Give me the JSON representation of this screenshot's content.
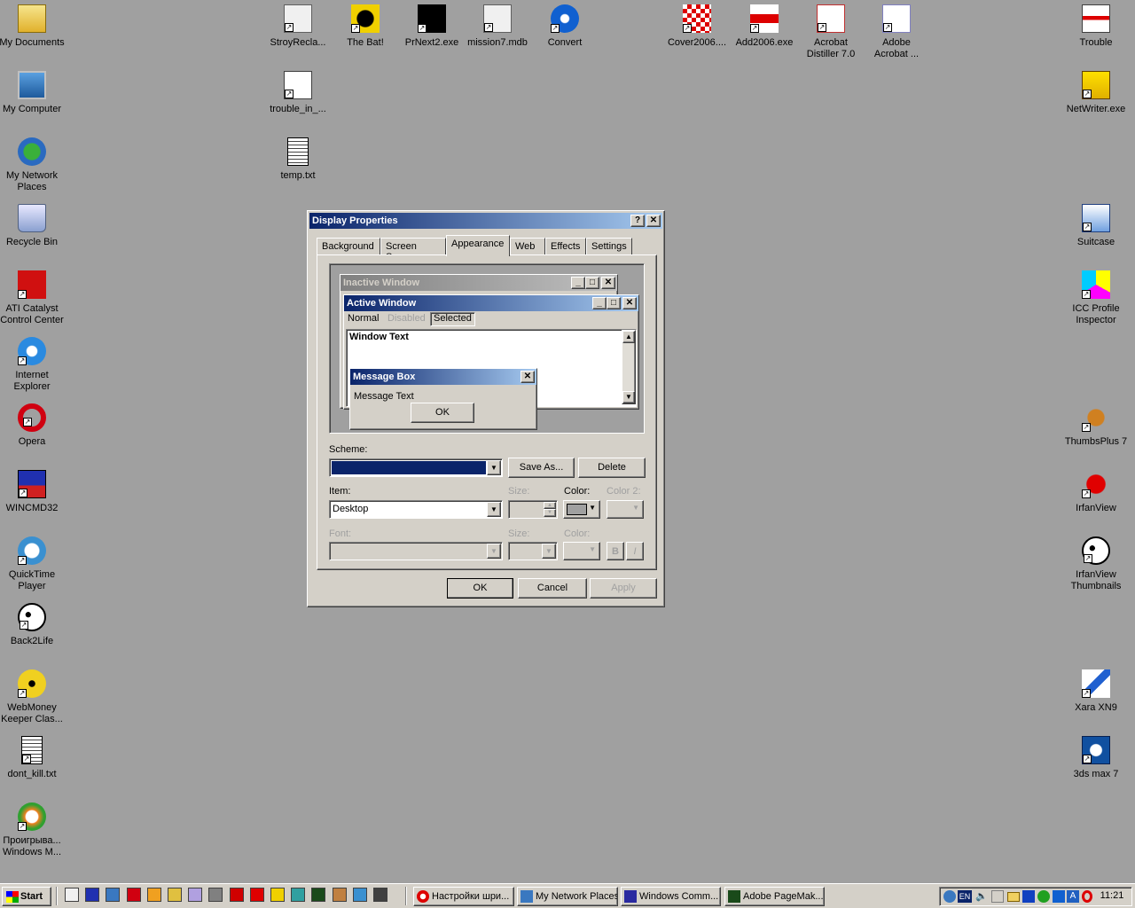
{
  "desktop": {
    "icons": [
      {
        "label": "My Documents",
        "icon": "folder-icon"
      },
      {
        "label": "My Computer",
        "icon": "computer-icon"
      },
      {
        "label": "My Network\nPlaces",
        "icon": "network-icon"
      },
      {
        "label": "Recycle Bin",
        "icon": "recycle-bin-icon"
      },
      {
        "label": "ATI Catalyst\nControl Center",
        "icon": "ati-icon"
      },
      {
        "label": "Internet\nExplorer",
        "icon": "ie-icon"
      },
      {
        "label": "Opera",
        "icon": "opera-icon"
      },
      {
        "label": "WINCMD32",
        "icon": "floppy-icon"
      },
      {
        "label": "QuickTime\nPlayer",
        "icon": "quicktime-icon"
      },
      {
        "label": "Back2Life",
        "icon": "panda-icon"
      },
      {
        "label": "WebMoney\nKeeper Clas...",
        "icon": "webmoney-icon"
      },
      {
        "label": "dont_kill.txt",
        "icon": "text-file-icon"
      },
      {
        "label": "Проигрыва...\nWindows M...",
        "icon": "media-player-icon"
      },
      {
        "label": "StroyRecla...",
        "icon": "setup-icon"
      },
      {
        "label": "trouble_in_...",
        "icon": "word-doc-icon"
      },
      {
        "label": "temp.txt",
        "icon": "text-file-icon"
      },
      {
        "label": "The Bat!",
        "icon": "bat-icon"
      },
      {
        "label": "PrNext2.exe",
        "icon": "prnext-icon"
      },
      {
        "label": "mission7.mdb",
        "icon": "setup-icon"
      },
      {
        "label": "Convert",
        "icon": "convert-icon"
      },
      {
        "label": "Cover2006....",
        "icon": "cover-icon"
      },
      {
        "label": "Add2006.exe",
        "icon": "red-cross-icon"
      },
      {
        "label": "Acrobat\nDistiller 7.0",
        "icon": "acrobat-distiller-icon"
      },
      {
        "label": "Adobe\nAcrobat ...",
        "icon": "acrobat-icon"
      },
      {
        "label": "Trouble",
        "icon": "trouble-icon"
      },
      {
        "label": "NetWriter.exe",
        "icon": "netwriter-icon"
      },
      {
        "label": "Suitcase",
        "icon": "suitcase-icon"
      },
      {
        "label": "ICC Profile\nInspector",
        "icon": "icc-icon"
      },
      {
        "label": "ThumbsPlus 7",
        "icon": "thumbsplus-icon"
      },
      {
        "label": "IrfanView",
        "icon": "irfanview-icon"
      },
      {
        "label": "IrfanView\nThumbnails",
        "icon": "panda-icon"
      },
      {
        "label": "Xara XN9",
        "icon": "xara-icon"
      },
      {
        "label": "3ds max 7",
        "icon": "3dsmax-icon"
      }
    ]
  },
  "dialog": {
    "title": "Display Properties",
    "tabs": [
      "Background",
      "Screen Saver",
      "Appearance",
      "Web",
      "Effects",
      "Settings"
    ],
    "preview": {
      "inactive_title": "Inactive Window",
      "active_title": "Active Window",
      "menu": [
        "Normal",
        "Disabled",
        "Selected"
      ],
      "window_text": "Window Text",
      "msgbox_title": "Message Box",
      "msgbox_text": "Message Text",
      "msgbox_ok": "OK"
    },
    "scheme_label": "Scheme:",
    "scheme_value": "",
    "save_as": "Save As...",
    "delete": "Delete",
    "item_label": "Item:",
    "item_value": "Desktop",
    "size_label": "Size:",
    "color_label": "Color:",
    "color2_label": "Color 2:",
    "font_label": "Font:",
    "font_size_label": "Size:",
    "font_color_label": "Color:",
    "bold": "B",
    "italic": "I",
    "ok": "OK",
    "cancel": "Cancel",
    "apply": "Apply",
    "colors": {
      "desktop": "#a0a0a0",
      "active_title": "#0a246a",
      "face": "#d4d0c8"
    }
  },
  "taskbar": {
    "start": "Start",
    "tasks": [
      "Настройки шри...",
      "My Network Places",
      "Windows Comm...",
      "Adobe PageMak..."
    ],
    "lang": "EN",
    "clock": "11:21"
  }
}
